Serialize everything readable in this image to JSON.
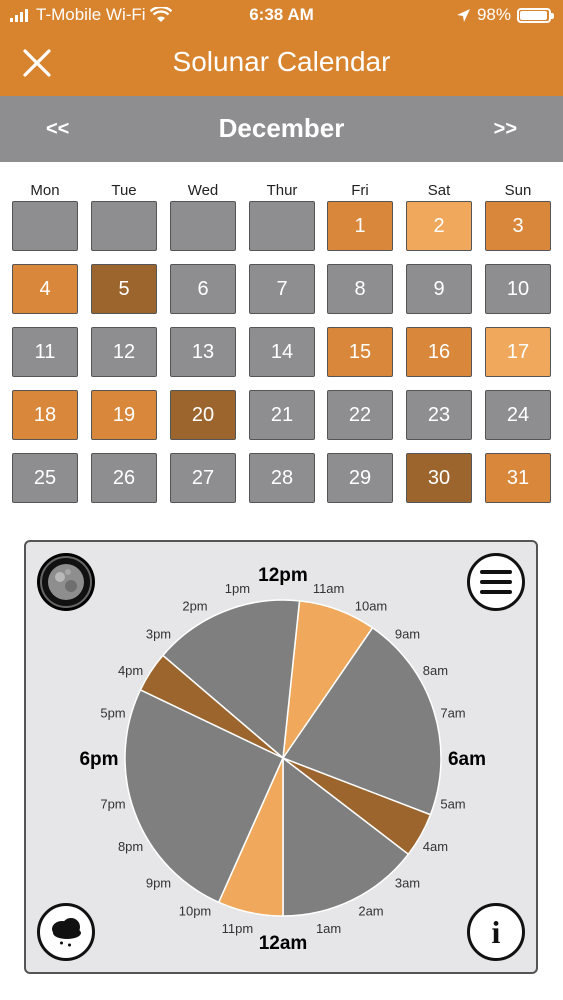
{
  "status": {
    "carrier": "T-Mobile Wi-Fi",
    "time": "6:38 AM",
    "battery": "98%",
    "battery_level": 0.98
  },
  "header": {
    "title": "Solunar Calendar"
  },
  "month": {
    "prev_label": "<<",
    "name": "December",
    "next_label": ">>"
  },
  "weekdays": [
    "Mon",
    "Tue",
    "Wed",
    "Thur",
    "Fri",
    "Sat",
    "Sun"
  ],
  "colors": {
    "header": "#d8832e",
    "month_bar": "#8e8e90",
    "gray": "#8e8e90",
    "orange": "#d9873a",
    "light_orange": "#f0a95c",
    "dark_orange": "#9c652e"
  },
  "calendar": {
    "cells": [
      {
        "label": "",
        "rating": "empty"
      },
      {
        "label": "",
        "rating": "empty"
      },
      {
        "label": "",
        "rating": "empty"
      },
      {
        "label": "",
        "rating": "empty"
      },
      {
        "label": "1",
        "rating": "orange"
      },
      {
        "label": "2",
        "rating": "light"
      },
      {
        "label": "3",
        "rating": "orange"
      },
      {
        "label": "4",
        "rating": "orange"
      },
      {
        "label": "5",
        "rating": "dark"
      },
      {
        "label": "6",
        "rating": "gray"
      },
      {
        "label": "7",
        "rating": "gray"
      },
      {
        "label": "8",
        "rating": "gray"
      },
      {
        "label": "9",
        "rating": "gray"
      },
      {
        "label": "10",
        "rating": "gray"
      },
      {
        "label": "11",
        "rating": "gray"
      },
      {
        "label": "12",
        "rating": "gray"
      },
      {
        "label": "13",
        "rating": "gray"
      },
      {
        "label": "14",
        "rating": "gray"
      },
      {
        "label": "15",
        "rating": "orange"
      },
      {
        "label": "16",
        "rating": "orange"
      },
      {
        "label": "17",
        "rating": "light"
      },
      {
        "label": "18",
        "rating": "orange"
      },
      {
        "label": "19",
        "rating": "orange"
      },
      {
        "label": "20",
        "rating": "dark"
      },
      {
        "label": "21",
        "rating": "gray"
      },
      {
        "label": "22",
        "rating": "gray"
      },
      {
        "label": "23",
        "rating": "gray"
      },
      {
        "label": "24",
        "rating": "gray"
      },
      {
        "label": "25",
        "rating": "gray"
      },
      {
        "label": "26",
        "rating": "gray"
      },
      {
        "label": "27",
        "rating": "gray"
      },
      {
        "label": "28",
        "rating": "gray"
      },
      {
        "label": "29",
        "rating": "gray"
      },
      {
        "label": "30",
        "rating": "dark"
      },
      {
        "label": "31",
        "rating": "orange"
      }
    ]
  },
  "clock": {
    "hour_labels": [
      "12am",
      "1am",
      "2am",
      "3am",
      "4am",
      "5am",
      "6am",
      "7am",
      "8am",
      "9am",
      "10am",
      "11am",
      "12pm",
      "1pm",
      "2pm",
      "3pm",
      "4pm",
      "5pm",
      "6pm",
      "7pm",
      "8pm",
      "9pm",
      "10pm",
      "11pm"
    ],
    "major_labels": [
      "12am",
      "6am",
      "12pm",
      "6pm"
    ],
    "segments": [
      {
        "start": 0.0,
        "end": 3.5,
        "color": "gray"
      },
      {
        "start": 3.5,
        "end": 4.6,
        "color": "dark"
      },
      {
        "start": 4.6,
        "end": 9.7,
        "color": "gray"
      },
      {
        "start": 9.7,
        "end": 11.6,
        "color": "light"
      },
      {
        "start": 11.6,
        "end": 15.3,
        "color": "gray"
      },
      {
        "start": 15.3,
        "end": 16.3,
        "color": "dark"
      },
      {
        "start": 16.3,
        "end": 22.4,
        "color": "gray"
      },
      {
        "start": 22.4,
        "end": 24.0,
        "color": "light"
      }
    ]
  },
  "icons": {
    "close": "close-icon",
    "moon": "moon-icon",
    "menu": "menu-icon",
    "weather": "weather-icon",
    "info": "info-icon",
    "info_glyph": "i"
  }
}
